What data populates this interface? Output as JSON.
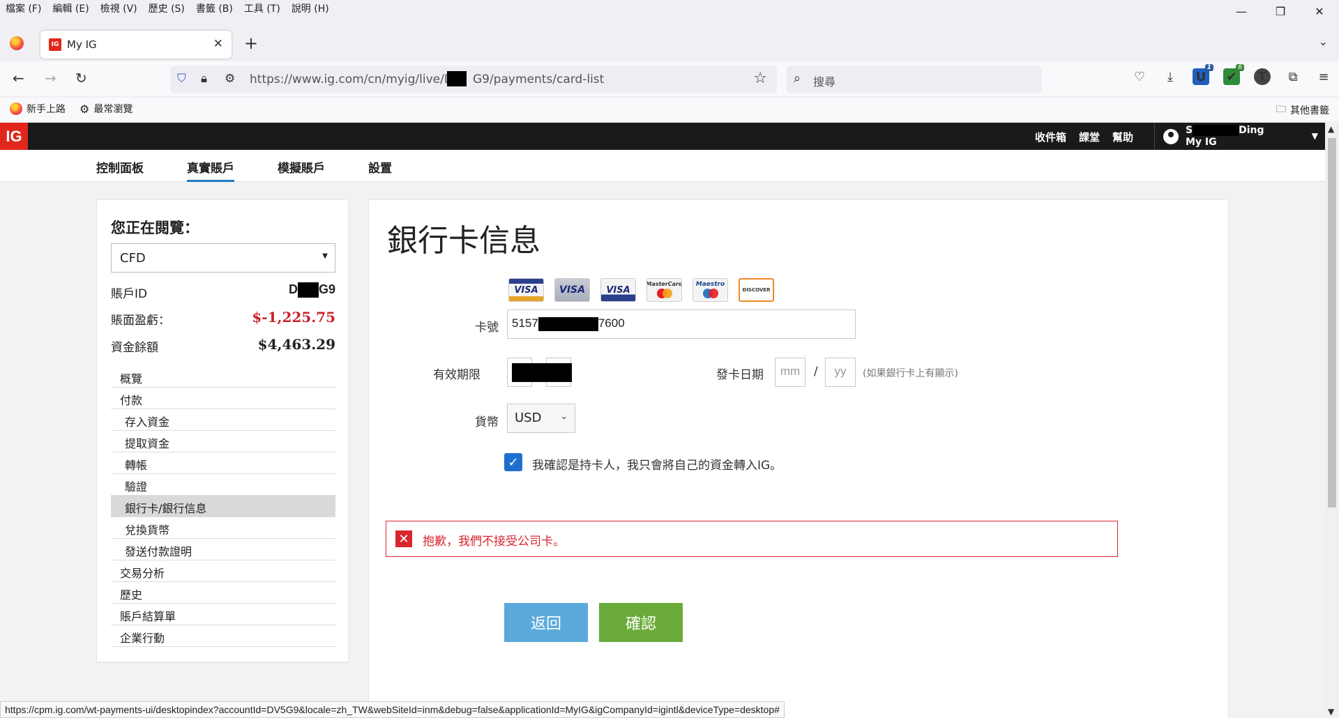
{
  "browser": {
    "menu": [
      "檔案 (F)",
      "編輯 (E)",
      "檢視 (V)",
      "歷史 (S)",
      "書籤 (B)",
      "工具 (T)",
      "說明 (H)"
    ],
    "tab_title": "My IG",
    "tab_favicon": "IG",
    "url": "https://www.ig.com/cn/myig/live/D███G9/payments/card-list",
    "url_left": "https://www.ig.com/cn/myig/live/D",
    "url_right": "G9/payments/card-list",
    "search_placeholder": "搜尋",
    "badge_blue": "1",
    "badge_green": "6",
    "profile_initial": "T",
    "bookmarks": [
      "新手上路",
      "最常瀏覽"
    ],
    "other_bookmarks": "其他書籤",
    "status_url": "https://cpm.ig.com/wt-payments-ui/desktopindex?accountId=DV5G9&locale=zh_TW&webSiteId=inm&debug=false&applicationId=MyIG&igCompanyId=igintl&deviceType=desktop#"
  },
  "header": {
    "logo": "IG",
    "links": [
      "收件箱",
      "課堂",
      "幫助"
    ],
    "user_first": "S",
    "user_last": "Ding",
    "user_app": "My IG",
    "tabs": [
      "控制面板",
      "真實賬戶",
      "模擬賬戶",
      "設置"
    ]
  },
  "sidebar": {
    "title": "您正在閱覽：",
    "account_type": "CFD",
    "account_id_label": "賬戶ID",
    "account_id_left": "D",
    "account_id_right": "G9",
    "pnl_label": "賬面盈虧：",
    "pnl_value": "$-1,225.75",
    "balance_label": "資金餘額",
    "balance_value": "$4,463.29",
    "nav": [
      {
        "label": "概覽",
        "sub": false
      },
      {
        "label": "付款",
        "sub": false
      },
      {
        "label": "存入資金",
        "sub": true
      },
      {
        "label": "提取資金",
        "sub": true
      },
      {
        "label": "轉帳",
        "sub": true
      },
      {
        "label": "驗證",
        "sub": true
      },
      {
        "label": "銀行卡/銀行信息",
        "sub": true,
        "selected": true
      },
      {
        "label": "兌換貨幣",
        "sub": true
      },
      {
        "label": "發送付款證明",
        "sub": true
      },
      {
        "label": "交易分析",
        "sub": false
      },
      {
        "label": "歷史",
        "sub": false
      },
      {
        "label": "賬戶結算單",
        "sub": false
      },
      {
        "label": "企業行動",
        "sub": false
      }
    ]
  },
  "main": {
    "heading": "銀行卡信息",
    "cards": [
      "VISA",
      "VISA",
      "VISA",
      "MasterCard",
      "Maestro",
      "DISCOVER"
    ],
    "card_number_label": "卡號",
    "card_number_start": "5157",
    "card_number_end": "7600",
    "expiry_label": "有效期限",
    "issue_label": "發卡日期",
    "issue_mm_placeholder": "mm",
    "issue_sep": "/",
    "issue_yy_placeholder": "yy",
    "issue_hint": "(如果銀行卡上有顯示)",
    "currency_label": "貨幣",
    "currency_value": "USD",
    "confirm_text": "我確認是持卡人，我只會將自己的資金轉入IG。",
    "error_text": "抱歉，我們不接受公司卡。",
    "back_button": "返回",
    "confirm_button": "確認"
  },
  "colors": {
    "ig_red": "#e1261c",
    "negative": "#c9202b",
    "back_btn": "#5ba9db",
    "confirm_btn": "#6aab3a",
    "error": "#d9252d"
  }
}
